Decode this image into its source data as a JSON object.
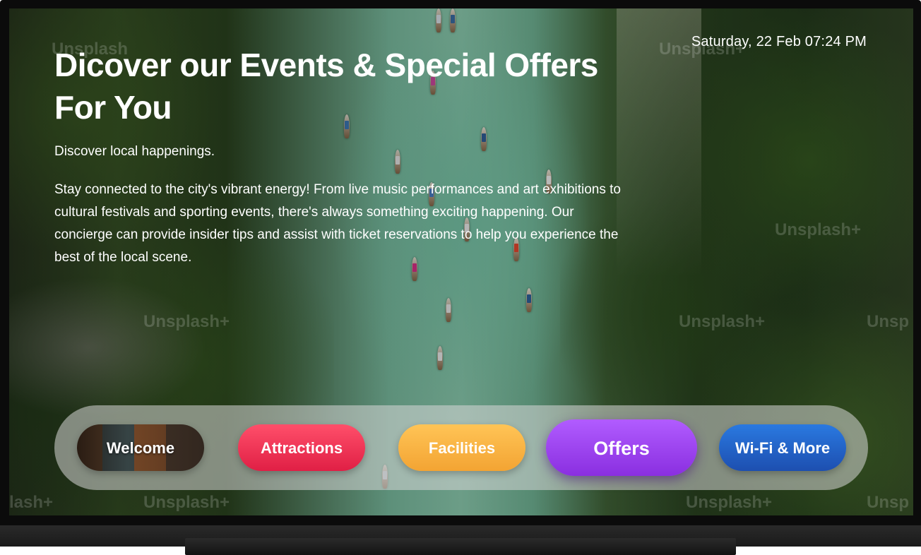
{
  "datetime": "Saturday, 22 Feb 07:24 PM",
  "hero": {
    "title_line1": "Dicover our Events & Special Offers",
    "title_line2": "For You",
    "subtitle": "Discover local happenings.",
    "description": "Stay connected to the city's vibrant energy! From live music performances and art exhibitions to cultural festivals and sporting events, there's always something exciting happening. Our concierge can provide insider tips and assist with ticket reservations to help you experience the best of the local scene."
  },
  "nav": {
    "items": [
      {
        "label": "Welcome"
      },
      {
        "label": "Attractions"
      },
      {
        "label": "Facilities"
      },
      {
        "label": "Offers",
        "selected": true
      },
      {
        "label": "Wi-Fi & More"
      }
    ]
  },
  "watermarks": {
    "w1": "Unsplash",
    "w2": "Unsplash+",
    "w3": "Unsplash+",
    "w4": "Unsplash+",
    "w5": "lash+",
    "w6": "Unsplash+",
    "w7": "Unsplash+",
    "w8": "Unsp",
    "w9": "Unsplash+",
    "w10": "Unsp"
  },
  "colors": {
    "attractions": "#e01f45",
    "facilities": "#f3a433",
    "offers": "#8a2fe0",
    "wifi": "#1d4fb0"
  }
}
